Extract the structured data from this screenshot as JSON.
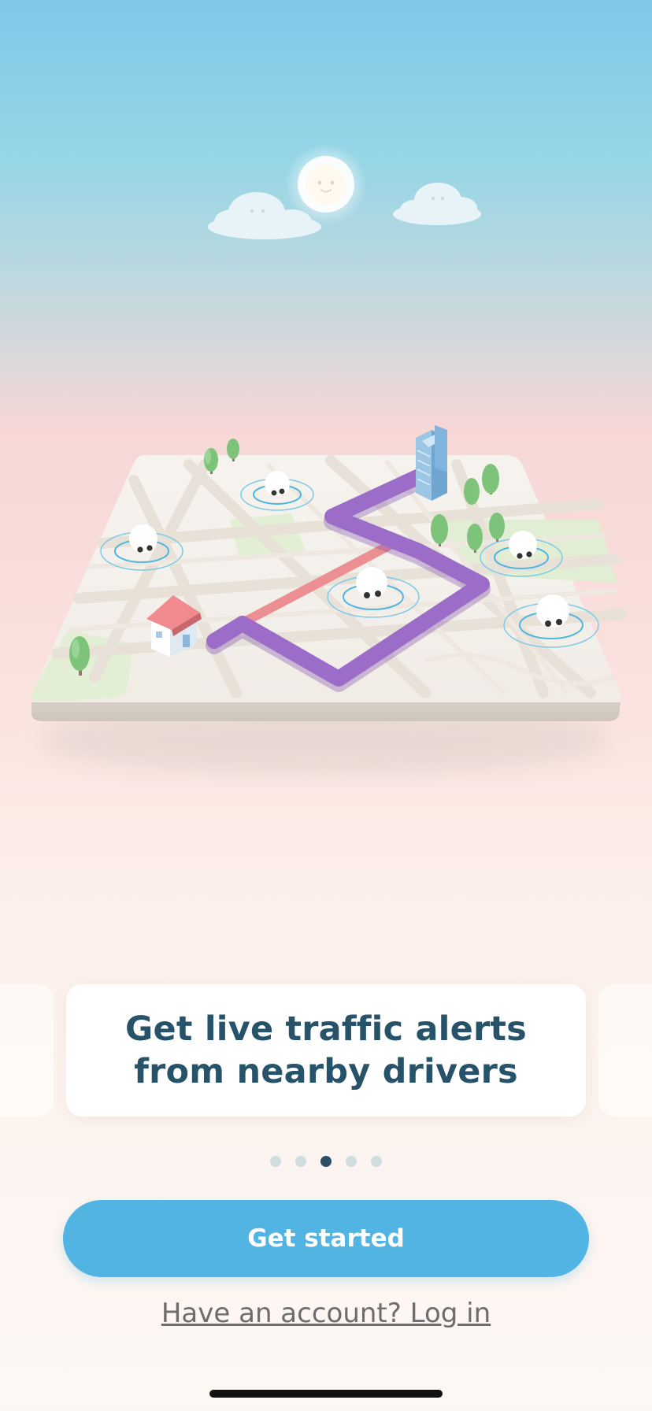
{
  "onboarding": {
    "slides": [
      {
        "title_line1": "",
        "title_line2": ""
      },
      {
        "title_line1": "",
        "title_line2": ""
      },
      {
        "title_line1": "Get live traffic alerts",
        "title_line2": "from nearby drivers"
      },
      {
        "title_line1": "",
        "title_line2": ""
      },
      {
        "title_line1": "",
        "title_line2": ""
      }
    ],
    "active_index": 2,
    "dots_count": 5,
    "get_started_label": "Get started",
    "login_prompt": "Have an account? Log in"
  },
  "colors": {
    "accent": "#52b4e2",
    "title": "#27536a",
    "route": "#9b6cc8",
    "traffic": "#e88a8f",
    "dot_active": "#2a4f66",
    "dot_inactive": "#d1dce1"
  },
  "illustration": {
    "sky_icons": [
      "sun-icon",
      "cloud-icon",
      "cloud-icon"
    ],
    "map_icons": [
      "house-icon",
      "building-icon",
      "tree-icon",
      "car-icon",
      "route-line",
      "traffic-line"
    ]
  }
}
